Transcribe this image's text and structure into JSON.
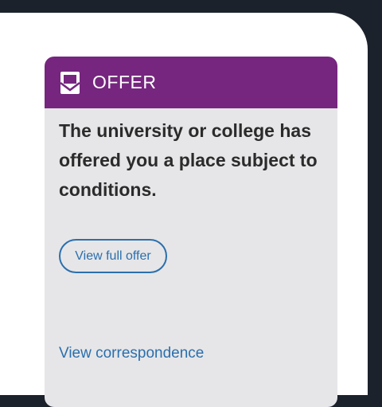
{
  "card": {
    "header": {
      "icon": "envelope-open-icon",
      "title": "OFFER",
      "color": "#76267f"
    },
    "message": "The university or college has offered you a place subject to conditions.",
    "view_offer_button": "View full offer",
    "correspondence_link": "View correspondence",
    "link_color": "#2b6fad",
    "background_color": "#e6e6e8"
  }
}
